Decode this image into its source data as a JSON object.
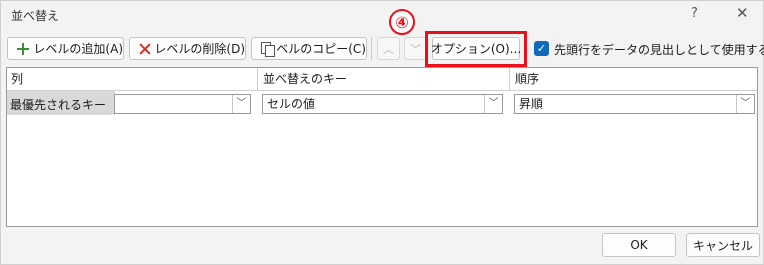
{
  "window": {
    "title": "並べ替え",
    "help": "?",
    "close": "✕"
  },
  "toolbar": {
    "add_label": "レベルの追加(A)",
    "delete_label": "レベルの削除(D)",
    "copy_label": "レベルのコピー(C)",
    "up_arrow": "︿",
    "down_arrow": "﹀",
    "options_label": "オプション(O)...",
    "header_checkbox_label": "先頭行をデータの見出しとして使用する(H)",
    "header_checkbox_checked": true
  },
  "annotation": {
    "badge": "④",
    "color": "#e8101a"
  },
  "grid": {
    "headers": [
      "列",
      "並べ替えのキー",
      "順序"
    ],
    "rows": [
      {
        "label": "最優先されるキー",
        "column_value": "",
        "key_value": "セルの値",
        "order_value": "昇順"
      }
    ]
  },
  "footer": {
    "ok_label": "OK",
    "cancel_label": "キャンセル"
  },
  "colors": {
    "checkbox": "#0f6cbd",
    "highlight": "#e8101a"
  }
}
